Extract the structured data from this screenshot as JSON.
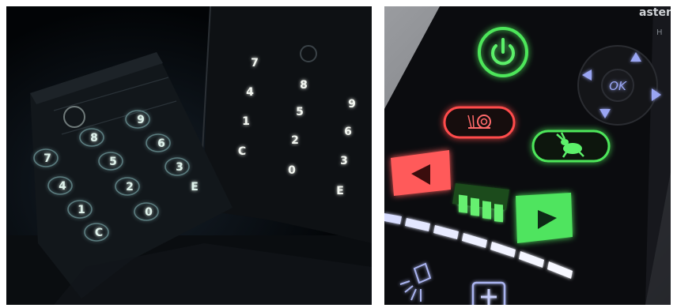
{
  "left_photo": {
    "tilted_keypad_keys": [
      "9",
      "8",
      "6",
      "7",
      "5",
      "3",
      "4",
      "2",
      "1",
      "0",
      "C",
      "E"
    ],
    "flat_keypad_keys": [
      "7",
      "8",
      "4",
      "5",
      "9",
      "1",
      "6",
      "2",
      "C",
      "0",
      "3",
      "E"
    ],
    "colors": {
      "background": "#020406",
      "key_glow": "#9fd3c8",
      "panel": "#0d1114"
    }
  },
  "right_photo": {
    "brand_fragment": "astenb",
    "model_fragment": "H",
    "nav_center_label": "OK",
    "colors": {
      "panel": "#0b0c0f",
      "green": "#4de65a",
      "red": "#ff4b4b",
      "blue": "#9aa6f4",
      "glow_white": "#f3f7ff"
    },
    "icons": [
      "power-icon",
      "snail-icon",
      "rabbit-icon",
      "play-left-icon",
      "play-right-icon",
      "level-bars-icon",
      "lamp-icon",
      "plus-icon",
      "arrow-up-icon",
      "arrow-down-icon",
      "arrow-left-icon",
      "arrow-right-icon"
    ],
    "level_bars_lit": 4,
    "level_bars_total": 4
  }
}
